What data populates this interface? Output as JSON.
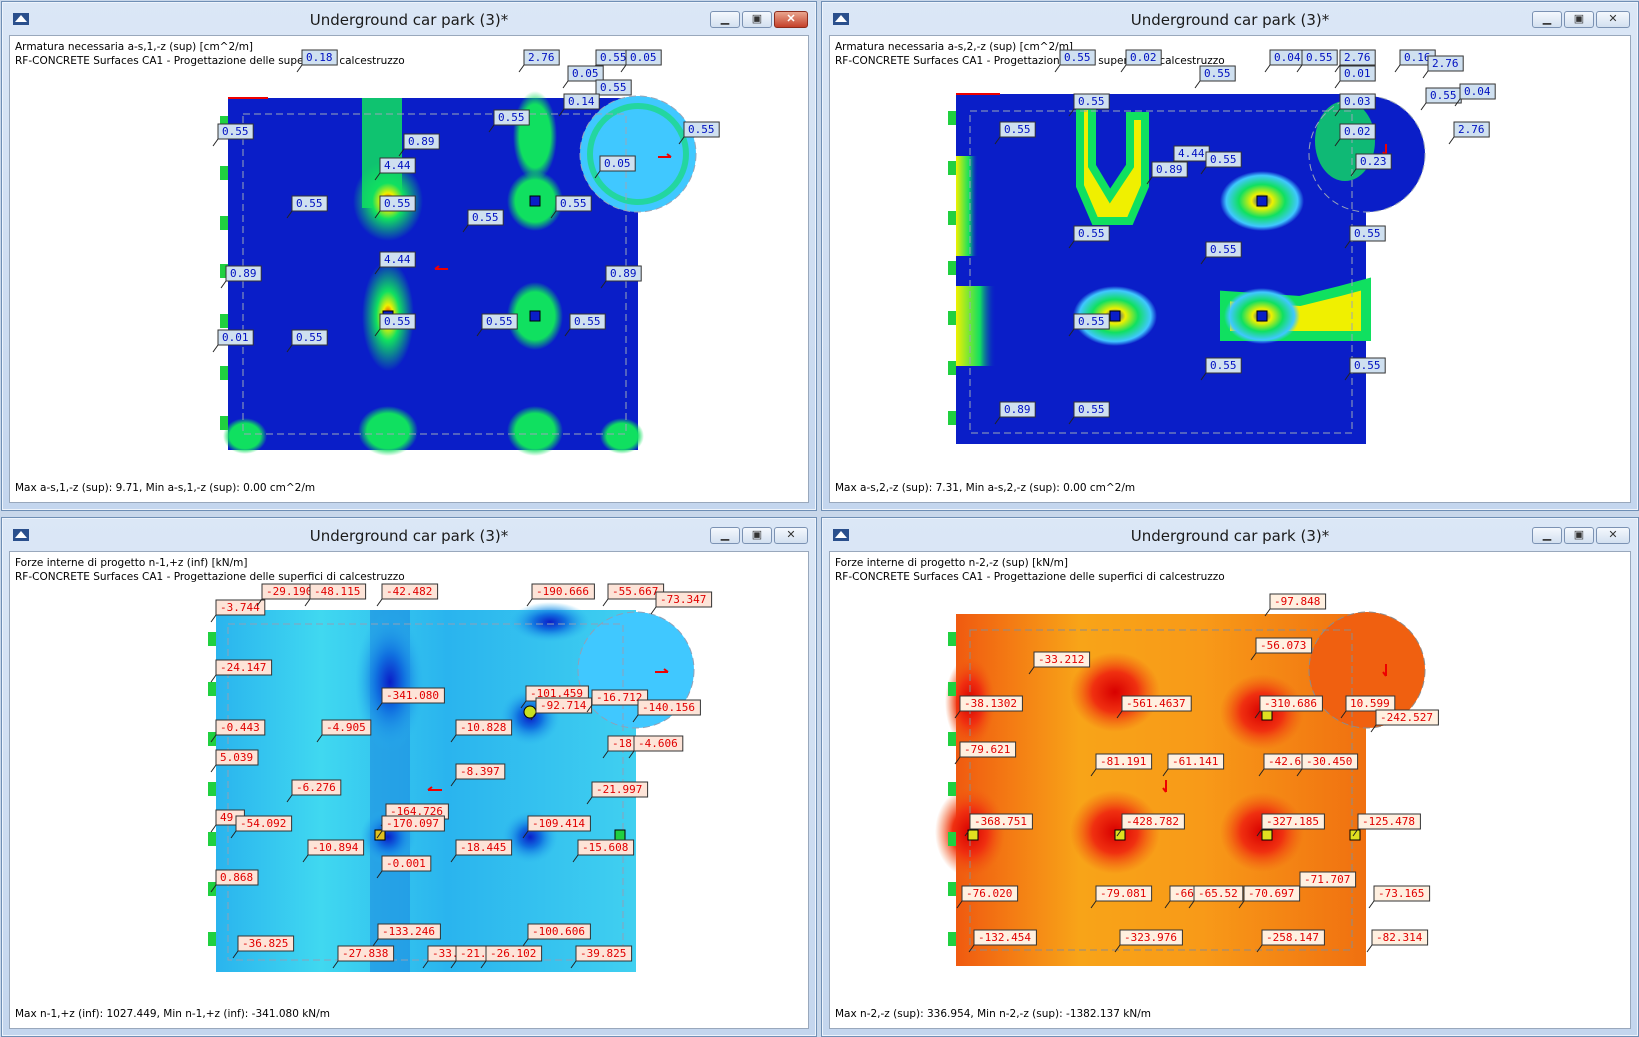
{
  "windows": [
    {
      "title": "Underground car park (3)*",
      "caption_line1": "Armatura necessaria a-s,1,-z (sup) [cm^2/m]",
      "caption_line2": "RF-CONCRETE Surfaces CA1 - Progettazione delle superfici di calcestruzzo",
      "status": "Max a-s,1,-z (sup): 9.71, Min a-s,1,-z (sup): 0.00 cm^2/m",
      "labels": [
        "0.18",
        "2.76",
        "0.55",
        "0.05",
        "0.05",
        "0.55",
        "0.14",
        "0.55",
        "0.55",
        "0.89",
        "4.44",
        "0.55",
        "0.05",
        "0.55",
        "0.55",
        "0.55",
        "0.55",
        "4.44",
        "0.89",
        "0.89",
        "0.55",
        "0.55",
        "0.55",
        "0.01",
        "0.55"
      ]
    },
    {
      "title": "Underground car park (3)*",
      "caption_line1": "Armatura necessaria a-s,2,-z (sup) [cm^2/m]",
      "caption_line2": "RF-CONCRETE Surfaces CA1 - Progettazione delle superfici di calcestruzzo",
      "status": "Max a-s,2,-z (sup): 7.31, Min a-s,2,-z (sup): 0.00 cm^2/m",
      "labels": [
        "0.55",
        "0.02",
        "0.04",
        "0.55",
        "2.76",
        "0.16",
        "2.76",
        "0.55",
        "0.01",
        "0.55",
        "0.03",
        "0.55",
        "0.04",
        "0.55",
        "0.02",
        "2.76",
        "4.44",
        "0.55",
        "0.89",
        "0.23",
        "0.55",
        "0.55",
        "0.55",
        "0.55",
        "0.55",
        "0.55",
        "0.89",
        "0.55"
      ]
    },
    {
      "title": "Underground car park (3)*",
      "caption_line1": "Forze interne di progetto n-1,+z (inf) [kN/m]",
      "caption_line2": "RF-CONCRETE Surfaces CA1 - Progettazione delle superfici di calcestruzzo",
      "status": "Max n-1,+z (inf): 1027.449, Min n-1,+z (inf): -341.080 kN/m",
      "labels": [
        "-3.744",
        "-29.190",
        "-48.115",
        "-42.482",
        "-190.666",
        "-55.667",
        "-73.347",
        "-24.147",
        "-341.080",
        "-101.459",
        "-92.714",
        "-16.712",
        "-140.156",
        "-0.443",
        "-4.905",
        "-10.828",
        "-18.",
        "-4.606",
        "5.039",
        "-8.397",
        "-6.276",
        "-21.997",
        "49.",
        "-54.092",
        "-164.726",
        "-170.097",
        "-109.414",
        "-10.894",
        "-0.001",
        "-18.445",
        "-15.608",
        "0.868",
        "-36.825",
        "-133.246",
        "-100.606",
        "-27.838",
        "-33.",
        "-21.",
        "-26.102",
        "-39.825"
      ]
    },
    {
      "title": "Underground car park (3)*",
      "caption_line1": "Forze interne di progetto n-2,-z (sup) [kN/m]",
      "caption_line2": "RF-CONCRETE Surfaces CA1 - Progettazione delle superfici di calcestruzzo",
      "status": "Max n-2,-z (sup): 336.954, Min n-2,-z (sup): -1382.137 kN/m",
      "labels": [
        "-97.848",
        "-56.073",
        "-33.212",
        "-38.1302",
        "-561.4637",
        "-310.686",
        "10.599",
        "-242.527",
        "-79.621",
        "-81.191",
        "-61.141",
        "-42.603",
        "-30.450",
        "-368.751",
        "-428.782",
        "-327.185",
        "-125.478",
        "-71.707",
        "-76.020",
        "-79.081",
        "-66.",
        "-65.52",
        "-70.697",
        "-73.165",
        "-132.454",
        "-323.976",
        "-258.147",
        "-82.314"
      ]
    }
  ],
  "icons": {
    "app": "rfem-app-icon",
    "minimize": "minimize-icon",
    "maximize": "maximize-icon",
    "close": "close-icon"
  },
  "colors": {
    "deep_blue": "#0a1ec8",
    "green": "#10e060",
    "yellow": "#f0f000",
    "light_blue": "#40c8ff",
    "cyan_bg": "#2ab4ee",
    "orange": "#f59a1a",
    "red": "#e82a10"
  }
}
